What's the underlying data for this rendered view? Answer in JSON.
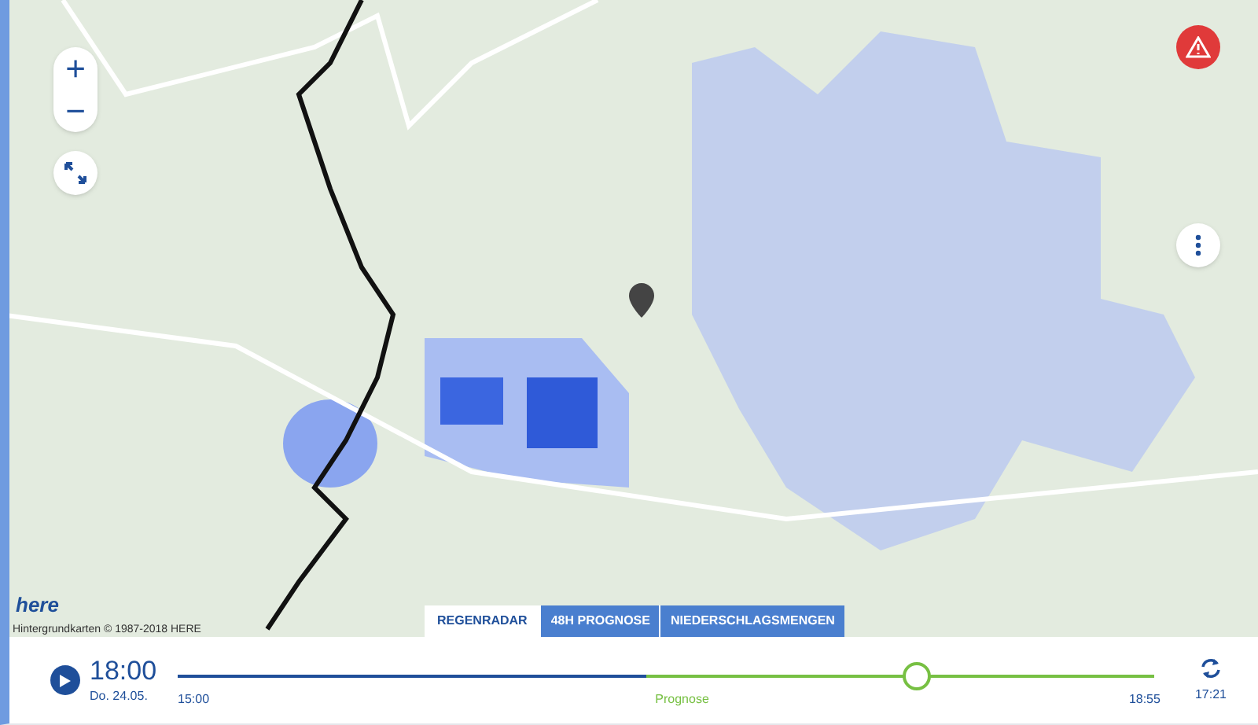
{
  "map": {
    "attribution": "Hintergrundkarten © 1987-2018 HERE",
    "logo": "here",
    "zoom_in": "+",
    "zoom_out": "−"
  },
  "tabs": [
    {
      "label": "REGENRADAR",
      "selected": true
    },
    {
      "label": "48H PROGNOSE",
      "selected": false
    },
    {
      "label": "NIEDERSCHLAGSMENGEN",
      "selected": false
    }
  ],
  "timeline": {
    "time": "18:00",
    "date": "Do. 24.05.",
    "start": "15:00",
    "forecast_label": "Prognose",
    "end": "18:55",
    "updated": "17:21",
    "past_segment": {
      "level": 0.48
    },
    "level": 0.757
  }
}
